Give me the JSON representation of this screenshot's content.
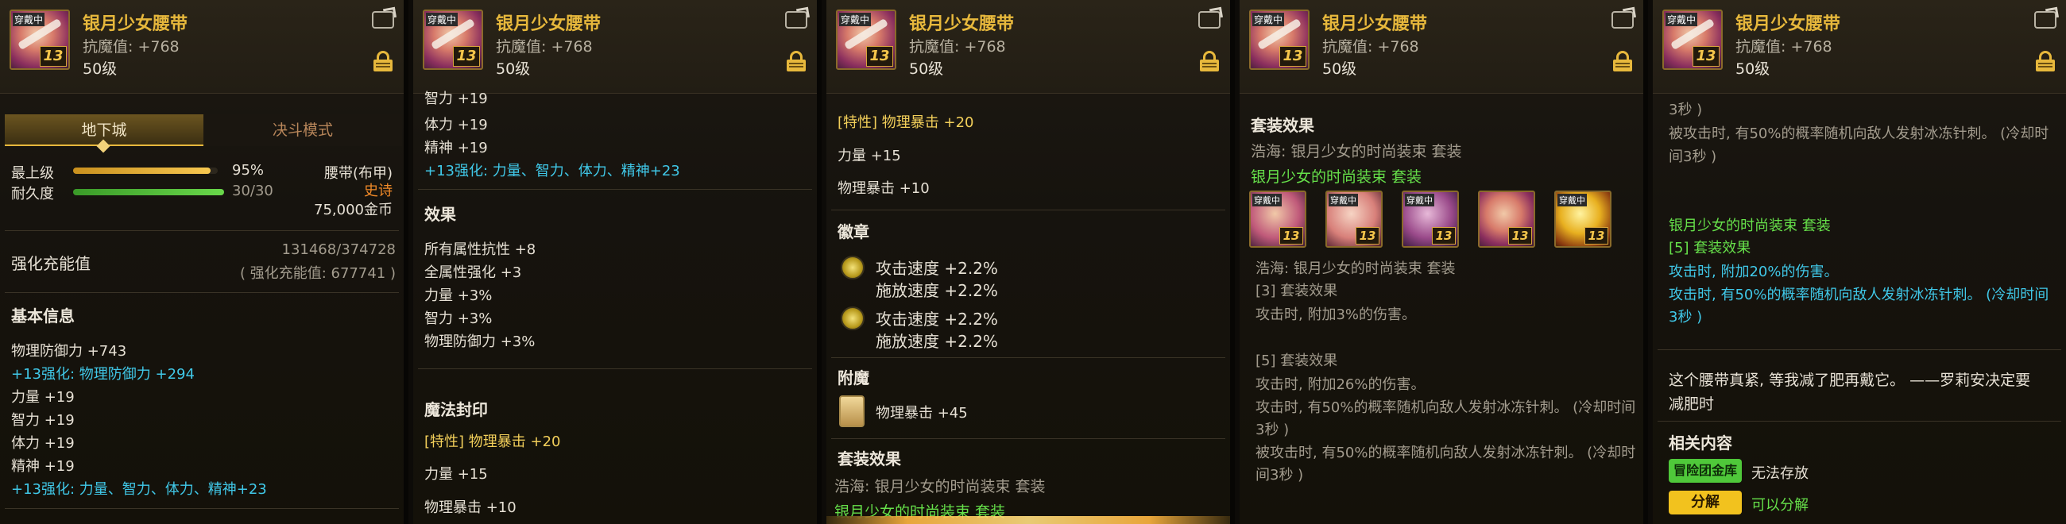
{
  "item": {
    "name": "银月少女腰带",
    "stat": "抗魔值: +768",
    "level": "50级",
    "tag": "穿戴中",
    "enhance_badge": "13"
  },
  "panel1": {
    "tabs": [
      "地下城",
      "决斗模式"
    ],
    "max_level_label": "最上级",
    "max_level_pct": "95%",
    "max_level_fraction": 0.95,
    "durability_label": "耐久度",
    "durability_value": "30/30",
    "durability_fraction": 1.0,
    "item_type": "腰带(布甲)",
    "rarity": "史诗",
    "price": "75,000金币",
    "charge_label": "强化充能值",
    "charge_value": "131468/374728",
    "charge_sub": "( 强化充能值: 677741 )",
    "basic_info_title": "基本信息",
    "basic_lines": [
      {
        "text": "物理防御力 +743",
        "color": "white"
      },
      {
        "text": "+13强化: 物理防御力 +294",
        "color": "cyan"
      },
      {
        "text": "力量 +19",
        "color": "white"
      },
      {
        "text": "智力 +19",
        "color": "white"
      },
      {
        "text": "体力 +19",
        "color": "white"
      },
      {
        "text": "精神 +19",
        "color": "white"
      },
      {
        "text": "+13强化: 力量、智力、体力、精神+23",
        "color": "cyan"
      }
    ]
  },
  "panel2": {
    "top_lines": [
      {
        "text": "智力 +19",
        "color": "white"
      },
      {
        "text": "体力 +19",
        "color": "white"
      },
      {
        "text": "精神 +19",
        "color": "white"
      },
      {
        "text": "+13强化: 力量、智力、体力、精神+23",
        "color": "cyan"
      }
    ],
    "effect_title": "效果",
    "effect_lines": [
      "所有属性抗性 +8",
      "全属性强化 +3",
      "力量 +3%",
      "智力 +3%",
      "物理防御力 +3%"
    ],
    "seal_title": "魔法封印",
    "seal_lines": [
      {
        "text": "[特性] 物理暴击 +20",
        "color": "yellow"
      },
      {
        "text": "力量 +15",
        "color": "white"
      },
      {
        "text": "物理暴击 +10",
        "color": "white"
      }
    ]
  },
  "panel3": {
    "seal_lines": [
      {
        "text": "[特性] 物理暴击 +20",
        "color": "yellow"
      },
      {
        "text": "力量 +15",
        "color": "white"
      },
      {
        "text": "物理暴击 +10",
        "color": "white"
      }
    ],
    "emblem_title": "徽章",
    "emblems": [
      {
        "line1": "攻击速度 +2.2%",
        "line2": "施放速度 +2.2%"
      },
      {
        "line1": "攻击速度 +2.2%",
        "line2": "施放速度 +2.2%"
      }
    ],
    "enchant_title": "附魔",
    "enchant_text": "物理暴击 +45",
    "set_title": "套装效果",
    "set_owner": "浩海: 银月少女的时尚装束 套装",
    "set_name": "银月少女的时尚装束 套装"
  },
  "panel4": {
    "set_title": "套装效果",
    "set_owner": "浩海: 银月少女的时尚装束 套装",
    "set_name": "银月少女的时尚装束 套装",
    "slot_badges": [
      "13",
      "13",
      "13",
      "13",
      "13"
    ],
    "slot_tags": [
      "穿戴中",
      "穿戴中",
      "穿戴中",
      "",
      "穿戴中"
    ],
    "set_owner2": "浩海: 银月少女的时尚装束 套装",
    "bonus3_title": "[3] 套装效果",
    "bonus3_line": "攻击时, 附加3%的伤害。",
    "bonus5_title": "[5] 套装效果",
    "bonus5_lines": [
      "攻击时, 附加26%的伤害。",
      "攻击时, 有50%的概率随机向敌人发射冰冻针刺。 (冷却时间",
      "3秒 )",
      "被攻击时, 有50%的概率随机向敌人发射冰冻针刺。 (冷却时",
      "间3秒 )"
    ]
  },
  "panel5": {
    "top_lines": [
      "3秒 )",
      "被攻击时, 有50%的概率随机向敌人发射冰冻针刺。 (冷却时",
      "间3秒 )"
    ],
    "set_name": "银月少女的时尚装束 套装",
    "bonus5_title": "[5] 套装效果",
    "bonus5_lines": [
      "攻击时, 附加20%的伤害。",
      "攻击时, 有50%的概率随机向敌人发射冰冻针刺。 (冷却时间",
      "3秒 )"
    ],
    "flavor_lines": [
      "这个腰带真紧, 等我减了肥再戴它。 ——罗莉安决定要",
      "减肥时"
    ],
    "related_title": "相关内容",
    "storage_badge": "冒险团金库",
    "storage_text": "无法存放",
    "disassemble_button": "分解",
    "disassemble_text": "可以分解"
  }
}
